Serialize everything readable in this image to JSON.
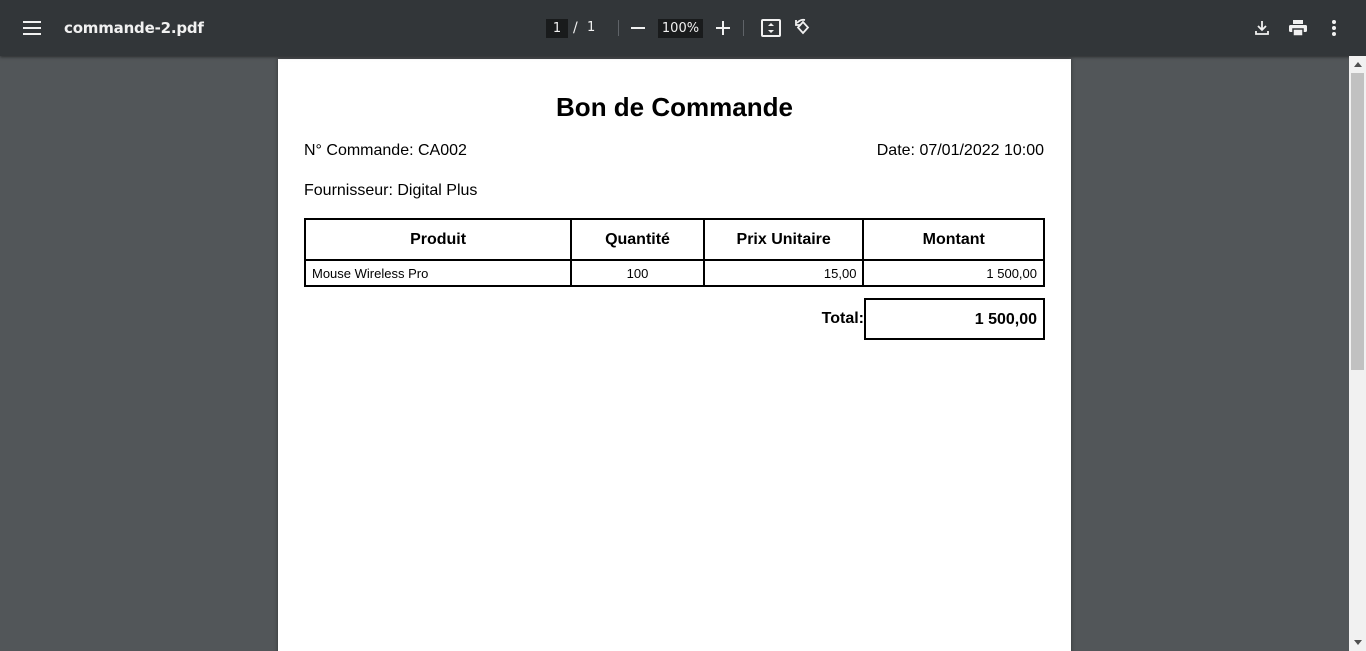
{
  "toolbar": {
    "title": "commande-2.pdf",
    "page_current": "1",
    "page_separator": "/",
    "page_total": "1",
    "zoom": "100%",
    "icons": [
      "menu-icon",
      "zoom-out-icon",
      "zoom-in-icon",
      "fit-to-page-icon",
      "rotate-icon",
      "download-icon",
      "print-icon",
      "more-vert-icon"
    ]
  },
  "document": {
    "heading": "Bon de Commande",
    "order_number": "N° Commande: CA002",
    "date": "Date: 07/01/2022 10:00",
    "supplier": "Fournisseur: Digital Plus",
    "table": {
      "headers": [
        "Produit",
        "Quantité",
        "Prix Unitaire",
        "Montant"
      ],
      "rows": [
        [
          "Mouse Wireless Pro",
          "100",
          "15,00",
          "1 500,00"
        ]
      ]
    },
    "total_label": "Total:",
    "total_value": "1 500,00"
  },
  "colors": {
    "toolbar_bg": "#323639",
    "viewer_bg": "#525659",
    "page_bg": "#ffffff"
  }
}
